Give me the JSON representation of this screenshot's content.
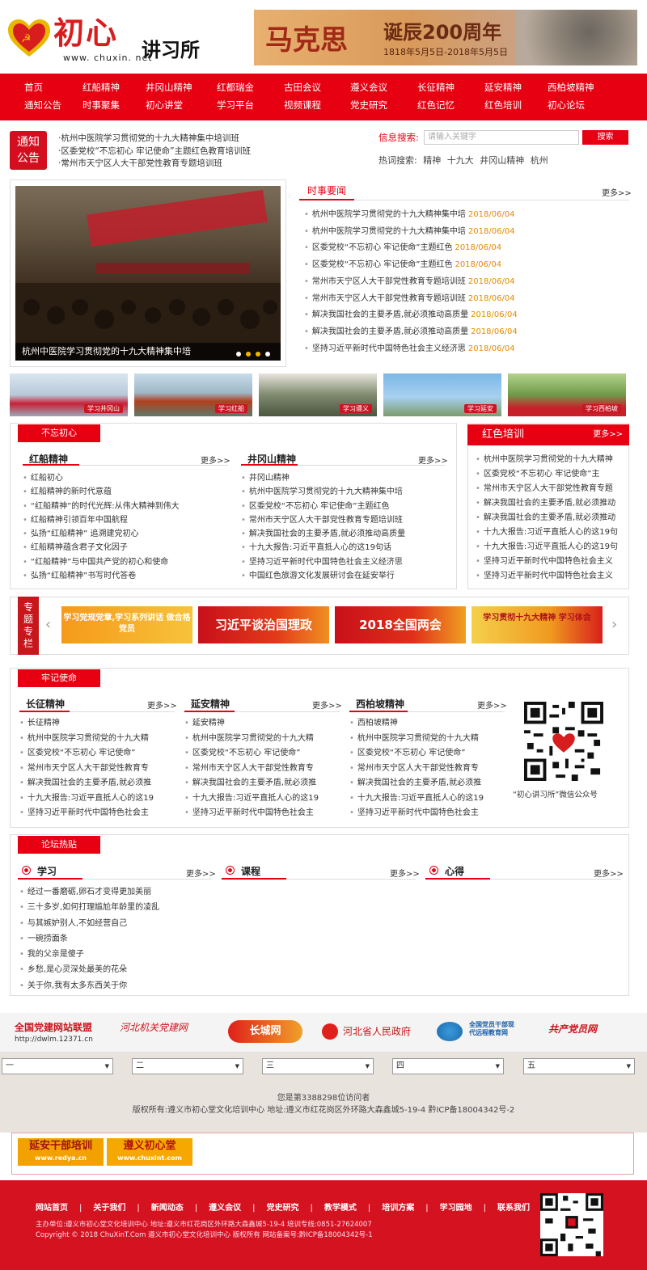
{
  "header": {
    "logo_title": "初心",
    "logo_subtitle": "讲习所",
    "logo_url": "www. chuxin. net",
    "banner_title": "马克思",
    "banner_subtitle": "诞辰200周年",
    "banner_dates": "1818年5月5日-2018年5月5日"
  },
  "nav": {
    "row1": [
      "首页",
      "红船精神",
      "井冈山精神",
      "红都瑞金",
      "古田会议",
      "遵义会议",
      "长征精神",
      "延安精神",
      "西柏坡精神"
    ],
    "row2": [
      "通知公告",
      "时事聚集",
      "初心讲堂",
      "学习平台",
      "视频课程",
      "党史研究",
      "红色记忆",
      "红色培训",
      "初心论坛"
    ]
  },
  "notice": {
    "label_line1": "通知",
    "label_line2": "公告",
    "items": [
      "·杭州中医院学习贯彻党的十九大精神集中培训班",
      "·区委党校“不忘初心 牢记使命”主题红色教育培训班",
      "·常州市天宁区人大干部党性教育专题培训班"
    ]
  },
  "search": {
    "label": "信息搜索:",
    "placeholder": "请输入关键字",
    "button": "搜索",
    "hot_label": "热词搜索:",
    "hot_words": [
      "精神",
      "十九大",
      "井冈山精神",
      "杭州"
    ]
  },
  "slider": {
    "caption": "杭州中医院学习贯彻党的十九大精神集中培"
  },
  "news": {
    "tab": "时事要闻",
    "more": "更多>>",
    "items": [
      {
        "title": "杭州中医院学习贯彻党的十九大精神集中培",
        "date": "2018/06/04"
      },
      {
        "title": "杭州中医院学习贯彻党的十九大精神集中培",
        "date": "2018/06/04"
      },
      {
        "title": "区委党校“不忘初心 牢记使命”主题红色",
        "date": "2018/06/04"
      },
      {
        "title": "区委党校“不忘初心 牢记使命”主题红色",
        "date": "2018/06/04"
      },
      {
        "title": "常州市天宁区人大干部党性教育专题培训班",
        "date": "2018/06/04"
      },
      {
        "title": "常州市天宁区人大干部党性教育专题培训班",
        "date": "2018/06/04"
      },
      {
        "title": "解决我国社会的主要矛盾,就必须推动高质量",
        "date": "2018/06/04"
      },
      {
        "title": "解决我国社会的主要矛盾,就必须推动高质量",
        "date": "2018/06/04"
      },
      {
        "title": "坚持习近平新时代中国特色社会主义经济思",
        "date": "2018/06/04"
      }
    ]
  },
  "thumbs": [
    "学习井冈山",
    "学习红船",
    "学习遵义",
    "学习延安",
    "学习西柏坡"
  ],
  "bwcx": {
    "tag": "不忘初心",
    "col1": {
      "title": "红船精神",
      "more": "更多>>",
      "items": [
        "红船初心",
        "红船精神的新时代意蕴",
        "“红船精神”的时代光辉:从伟大精神到伟大",
        "红船精神引领百年中国航程",
        "弘扬“红船精神” 追溯建党初心",
        "红船精神蕴含君子文化因子",
        "“红船精神”与中国共产党的初心和使命",
        "弘扬“红船精神”书写时代答卷"
      ]
    },
    "col2": {
      "title": "井冈山精神",
      "more": "更多>>",
      "items": [
        "井冈山精神",
        "杭州中医院学习贯彻党的十九大精神集中培",
        "区委党校“不忘初心 牢记使命”主题红色",
        "常州市天宁区人大干部党性教育专题培训班",
        "解决我国社会的主要矛盾,就必须推动高质量",
        "十九大报告:习近平直抵人心的这19句话",
        "坚持习近平新时代中国特色社会主义经济思",
        "中国红色旅游文化发展研讨会在延安举行"
      ]
    }
  },
  "hspx": {
    "title": "红色培训",
    "more": "更多>>",
    "items": [
      "杭州中医院学习贯彻党的十九大精神",
      "区委党校“不忘初心 牢记使命”主",
      "常州市天宁区人大干部党性教育专题",
      "解决我国社会的主要矛盾,就必须推动",
      "解决我国社会的主要矛盾,就必须推动",
      "十九大报告:习近平直抵人心的这19句",
      "十九大报告:习近平直抵人心的这19句",
      "坚持习近平新时代中国特色社会主义",
      "坚持习近平新时代中国特色社会主义"
    ]
  },
  "zt": {
    "tag": "专题专栏",
    "banners": [
      "学习党规党章,学习系列讲话 做合格党员",
      "习近平谈治国理政",
      "2018全国两会",
      "学习贯彻十九大精神 学习体会"
    ]
  },
  "ljsm": {
    "tag": "牢记使命",
    "cols": [
      {
        "title": "长征精神",
        "more": "更多>>",
        "items": [
          "长征精神",
          "杭州中医院学习贯彻党的十九大精",
          "区委党校“不忘初心 牢记使命”",
          "常州市天宁区人大干部党性教育专",
          "解决我国社会的主要矛盾,就必须推",
          "十九大报告:习近平直抵人心的这19",
          "坚持习近平新时代中国特色社会主"
        ]
      },
      {
        "title": "延安精神",
        "more": "更多>>",
        "items": [
          "延安精神",
          "杭州中医院学习贯彻党的十九大精",
          "区委党校“不忘初心 牢记使命”",
          "常州市天宁区人大干部党性教育专",
          "解决我国社会的主要矛盾,就必须推",
          "十九大报告:习近平直抵人心的这19",
          "坚持习近平新时代中国特色社会主"
        ]
      },
      {
        "title": "西柏坡精神",
        "more": "更多>>",
        "items": [
          "西柏坡精神",
          "杭州中医院学习贯彻党的十九大精",
          "区委党校“不忘初心 牢记使命”",
          "常州市天宁区人大干部党性教育专",
          "解决我国社会的主要矛盾,就必须推",
          "十九大报告:习近平直抵人心的这19",
          "坚持习近平新时代中国特色社会主"
        ]
      }
    ],
    "qr_caption": "“初心讲习所”微信公众号"
  },
  "forum": {
    "tag": "论坛热贴",
    "tabs": [
      {
        "title": "学习",
        "more": "更多>>"
      },
      {
        "title": "课程",
        "more": "更多>>"
      },
      {
        "title": "心得",
        "more": "更多>>"
      }
    ],
    "items": [
      "经过一番磨砺,卵石才变得更加美丽",
      "三十多岁,如何打理尴尬年龄里的凌乱",
      "与其嫉妒别人,不如经营自己",
      "一碗捞面条",
      "我的父亲是傻子",
      "乡愁,是心灵深处最美的花朵",
      "关于你,我有太多东西关于你"
    ]
  },
  "partners": {
    "p1": "全国党建网站联盟",
    "p1_url": "http://dwlm.12371.cn",
    "p2": "河北机关党建网",
    "p3": "长城网",
    "p4": "河北省人民政府",
    "p5": "全国党员干部现代远程教育网",
    "p6": "共产党员网"
  },
  "selects": [
    "一",
    "二",
    "三",
    "四",
    "五"
  ],
  "copyright": {
    "visits": "您是第3388298位访问者",
    "line": "版权所有:遵义市初心堂文化培训中心 地址:遵义市红花岗区外环路大森鑫城5-19-4 黔ICP备18004342号-2"
  },
  "ads": {
    "a1_line1": "延安干部培训",
    "a1_line2": "www.redya.cn",
    "a2_line1": "遵义初心堂",
    "a2_line2": "www.chuxint.com"
  },
  "footer": {
    "links": [
      "网站首页",
      "关于我们",
      "新闻动态",
      "遵义会议",
      "党史研究",
      "教学模式",
      "培训方案",
      "学习园地",
      "联系我们"
    ],
    "info1": "主办单位:遵义市初心堂文化培训中心 地址:遵义市红花岗区外环路大森鑫城5-19-4 培训专线:0851-27624007",
    "info2": "Copyright © 2018 ChuXinT.Com 遵义市初心堂文化培训中心 版权所有 网站备案号:黔ICP备18004342号-1"
  },
  "colors": {
    "primary": "#e60012",
    "accent_date": "#e68a00"
  }
}
